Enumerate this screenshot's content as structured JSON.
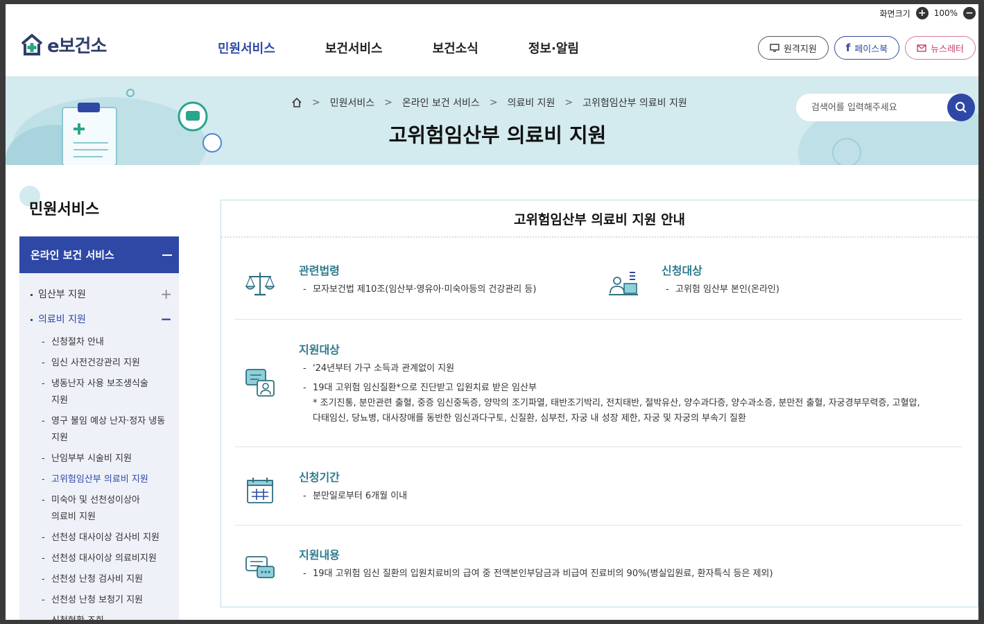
{
  "util": {
    "font_size_label": "화면크기",
    "zoom": "100%"
  },
  "logo": {
    "text": "e보건소"
  },
  "gnb": [
    "민원서비스",
    "보건서비스",
    "보건소식",
    "정보·알림"
  ],
  "header_buttons": {
    "remote": "원격지원",
    "facebook": "페이스북",
    "newsletter": "뉴스레터"
  },
  "breadcrumb": [
    "민원서비스",
    "온라인 보건 서비스",
    "의료비 지원",
    "고위험임산부 의료비 지원"
  ],
  "page_title": "고위험임산부 의료비 지원",
  "search": {
    "placeholder": "검색어를 입력해주세요"
  },
  "sidebar": {
    "title": "민원서비스",
    "section": "온라인 보건 서비스",
    "depth2": [
      {
        "label": "임산부 지원",
        "toggle": "+"
      },
      {
        "label": "의료비 지원",
        "toggle": "−"
      }
    ],
    "items": [
      "신청절차 안내",
      "임신 사전건강관리 지원",
      "냉동난자 사용 보조생식술",
      "지원",
      "영구 불임 예상 난자·정자 냉동",
      "지원",
      "난임부부 시술비 지원",
      "고위험임산부 의료비 지원",
      "미숙아 및 선천성이상아",
      "의료비 지원",
      "선천성 대사이상 검사비 지원",
      "선천성 대사이상 의료비지원",
      "선천성 난청 검사비 지원",
      "선천성 난청 보청기 지원",
      "신청현황 조회"
    ]
  },
  "content": {
    "title": "고위험임산부 의료비 지원 안내",
    "law": {
      "heading": "관련법령",
      "items": [
        "모자보건법 제10조(임산부·영유아·미숙아등의 건강관리 등)"
      ]
    },
    "applicant": {
      "heading": "신청대상",
      "items": [
        "고위험 임산부 본인(온라인)"
      ]
    },
    "target": {
      "heading": "지원대상",
      "items": [
        "'24년부터 가구 소득과 관계없이 지원",
        "19대 고위험 임신질환*으로 진단받고 입원치료 받은 임산부"
      ],
      "note1": "* 조기진통, 분만관련 출혈, 중증 임신중독증, 양막의 조기파열, 태반조기박리, 전치태반, 절박유산, 양수과다증, 양수과소증, 분만전 출혈, 자궁경부무력증, 고혈압,",
      "note2": "다태임신, 당뇨병, 대사장애를 동반한 임신과다구토, 신질환, 심부전, 자궁 내 성장 제한, 자궁 및 자궁의 부속기 질환"
    },
    "period": {
      "heading": "신청기간",
      "items": [
        "분만일로부터 6개월 이내"
      ]
    },
    "benefit": {
      "heading": "지원내용",
      "items": [
        "19대 고위험 임신 질환의 입원치료비의 급여 중 전액본인부담금과 비급여 진료비의 90%(병실입원료, 환자특식 등은 제외)"
      ]
    }
  },
  "colors": {
    "primary": "#2f48a6",
    "teal": "#2e7a8f",
    "banner": "#d3eaee"
  }
}
